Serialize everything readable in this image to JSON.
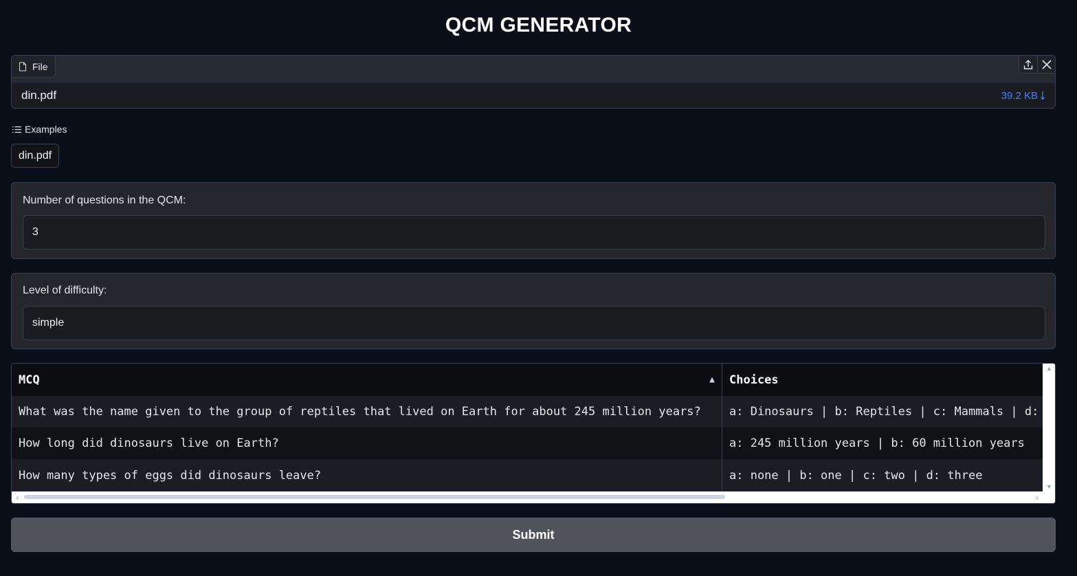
{
  "app": {
    "title": "QCM GENERATOR"
  },
  "file": {
    "tab_label": "File",
    "name": "din.pdf",
    "size": "39.2 KB",
    "tab_icon": "file-icon",
    "upload_icon": "upload-icon",
    "clear_icon": "close-icon",
    "download_icon": "download-arrow-icon"
  },
  "examples": {
    "label": "Examples",
    "icon": "list-icon",
    "items": [
      "din.pdf"
    ]
  },
  "num_questions": {
    "label": "Number of questions in the QCM:",
    "value": "3"
  },
  "difficulty": {
    "label": "Level of difficulty:",
    "value": "simple"
  },
  "table": {
    "headers": [
      "MCQ",
      "Choices"
    ],
    "sort_indicator": "▲",
    "rows": [
      [
        "What was the name given to the group of reptiles that lived on Earth for about 245 million years?",
        "a: Dinosaurs | b: Reptiles | c: Mammals | d: Birds"
      ],
      [
        "How long did dinosaurs live on Earth?",
        "a: 245 million years | b: 60 million years"
      ],
      [
        "How many types of eggs did dinosaurs leave?",
        "a: none | b: one | c: two | d: three"
      ]
    ]
  },
  "submit": {
    "label": "Submit"
  },
  "colors": {
    "accent_link": "#3b82f6",
    "background": "#0b0f19",
    "submit_bg": "#50525c"
  }
}
